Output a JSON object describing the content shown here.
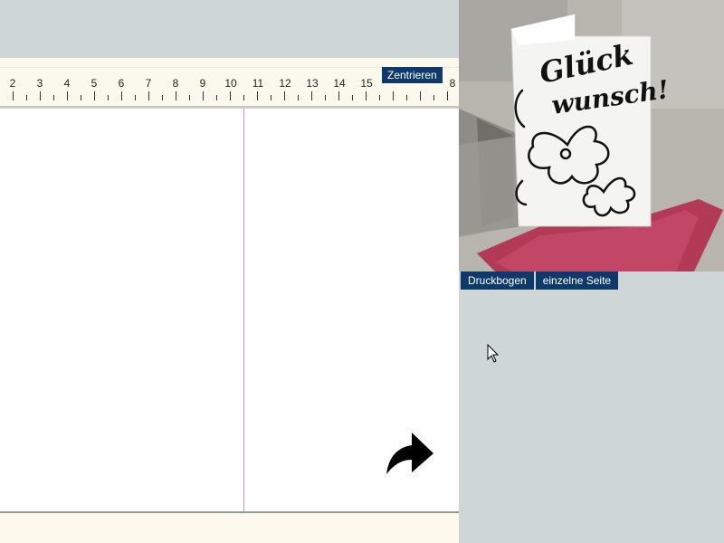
{
  "ruler": {
    "numbers": [
      "2",
      "3",
      "4",
      "5",
      "6",
      "7",
      "8",
      "9",
      "10",
      "11",
      "12",
      "13",
      "14",
      "15",
      "8"
    ],
    "center_button": "Zentrieren"
  },
  "preview": {
    "card_text_line1": "Glück",
    "card_text_line2": "wunsch!",
    "buttons": [
      "Druckbogen",
      "einzelne Seite"
    ]
  },
  "colors": {
    "accent": "#0e3a6b",
    "fold_line": "#d889d9",
    "envelope": "#b23a56",
    "panel_bg": "#cfd7d6"
  },
  "icons": {
    "next": "forward-arrow-icon",
    "cursor": "mouse-pointer-icon"
  }
}
